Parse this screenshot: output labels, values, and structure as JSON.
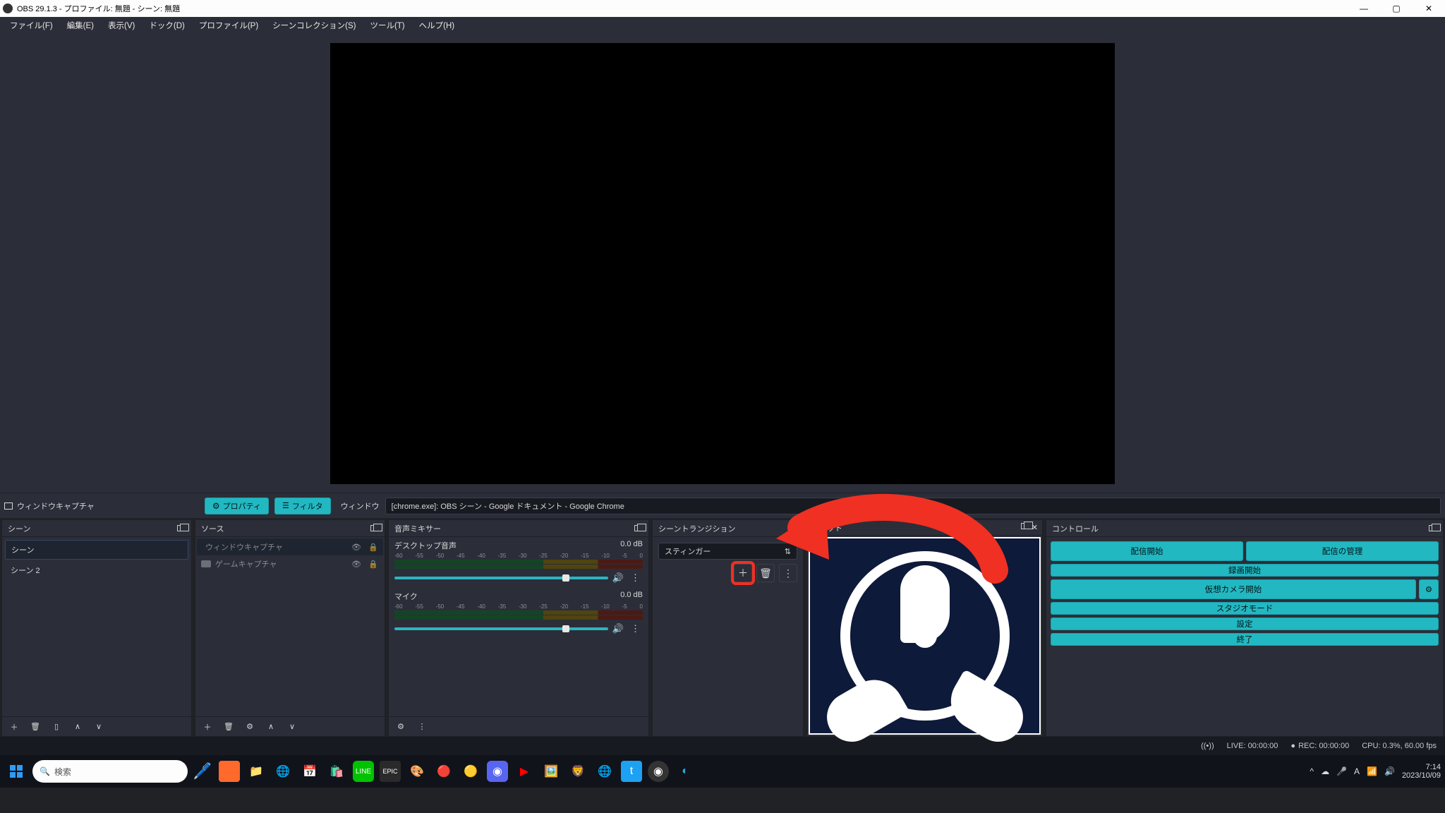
{
  "window": {
    "title": "OBS 29.1.3 - プロファイル: 無題 - シーン: 無題"
  },
  "menubar": {
    "file": "ファイル(F)",
    "edit": "編集(E)",
    "view": "表示(V)",
    "dock": "ドック(D)",
    "profile": "プロファイル(P)",
    "scene_collection": "シーンコレクション(S)",
    "tools": "ツール(T)",
    "help": "ヘルプ(H)"
  },
  "context_bar": {
    "source_name": "ウィンドウキャプチャ",
    "properties_btn": "プロパティ",
    "filters_btn": "フィルタ",
    "window_label": "ウィンドウ",
    "window_value": "[chrome.exe]: OBS シーン - Google ドキュメント - Google Chrome"
  },
  "docks": {
    "scenes": {
      "title": "シーン",
      "items": [
        "シーン",
        "シーン 2"
      ],
      "selected": 0
    },
    "sources": {
      "title": "ソース",
      "items": [
        {
          "name": "ウィンドウキャプチャ",
          "visible": false,
          "locked": true,
          "selected": true,
          "type": "window"
        },
        {
          "name": "ゲームキャプチャ",
          "visible": false,
          "locked": true,
          "selected": false,
          "type": "game"
        }
      ]
    },
    "mixer": {
      "title": "音声ミキサー",
      "channels": [
        {
          "name": "デスクトップ音声",
          "db": "0.0 dB"
        },
        {
          "name": "マイク",
          "db": "0.0 dB"
        }
      ],
      "scale": [
        "-60",
        "-55",
        "-50",
        "-45",
        "-40",
        "-35",
        "-30",
        "-25",
        "-20",
        "-15",
        "-10",
        "-5",
        "0"
      ]
    },
    "transitions": {
      "title": "シーントランジション",
      "selected": "スティンガー"
    },
    "chat": {
      "title": "チャット"
    },
    "controls": {
      "title": "コントロール",
      "start_stream": "配信開始",
      "manage_stream": "配信の管理",
      "start_record": "録画開始",
      "start_vcam": "仮想カメラ開始",
      "studio_mode": "スタジオモード",
      "settings": "設定",
      "exit": "終了"
    }
  },
  "statusbar": {
    "live": "LIVE: 00:00:00",
    "rec": "REC: 00:00:00",
    "cpu": "CPU: 0.3%, 60.00 fps"
  },
  "taskbar": {
    "search_placeholder": "検索",
    "time": "7:14",
    "date": "2023/10/09"
  }
}
